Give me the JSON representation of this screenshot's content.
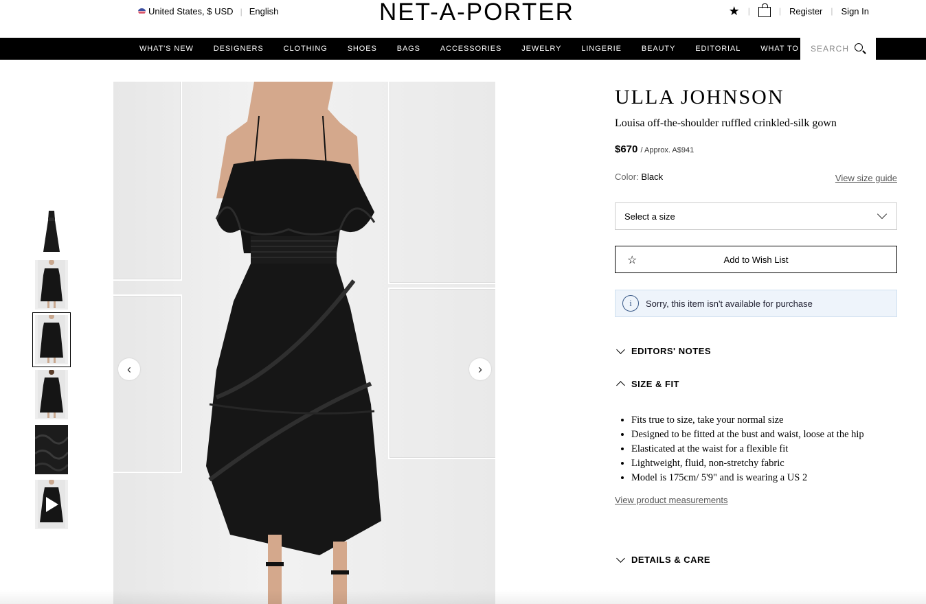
{
  "header": {
    "locale": "United States, $ USD",
    "language": "English",
    "logo": "NET-A-PORTER",
    "register": "Register",
    "sign_in": "Sign In"
  },
  "nav": {
    "items": [
      "WHAT'S NEW",
      "DESIGNERS",
      "CLOTHING",
      "SHOES",
      "BAGS",
      "ACCESSORIES",
      "JEWELRY",
      "LINGERIE",
      "BEAUTY",
      "EDITORIAL",
      "WHAT TO WEAR"
    ],
    "search_label": "SEARCH"
  },
  "gallery": {
    "thumbnail_count": 6,
    "active_index": 2,
    "video_index": 5
  },
  "product": {
    "designer": "ULLA JOHNSON",
    "name": "Louisa off-the-shoulder ruffled crinkled-silk gown",
    "price": "$670",
    "approx": "/ Approx. A$941",
    "color_label": "Color:",
    "color_value": "Black",
    "size_guide": "View size guide",
    "size_placeholder": "Select a size",
    "wishlist_label": "Add to Wish List",
    "unavailable_notice": "Sorry, this item isn't available for purchase"
  },
  "sections": {
    "editors_notes": "EDITORS' NOTES",
    "size_fit": "SIZE & FIT",
    "size_fit_points": [
      "Fits true to size, take your normal size",
      "Designed to be fitted at the bust and waist, loose at the hip",
      "Elasticated at the waist for a flexible fit",
      "Lightweight, fluid, non-stretchy fabric",
      "Model is 175cm/ 5'9\" and is wearing a US 2"
    ],
    "measurements_link": "View product measurements",
    "details_care": "DETAILS & CARE"
  }
}
